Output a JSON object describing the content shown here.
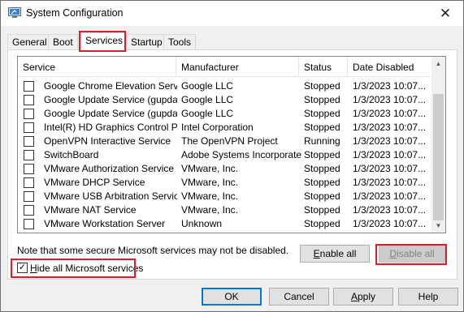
{
  "window": {
    "title": "System Configuration",
    "close_glyph": "✕"
  },
  "tabs": [
    {
      "label": "General",
      "active": false
    },
    {
      "label": "Boot",
      "active": false
    },
    {
      "label": "Services",
      "active": true
    },
    {
      "label": "Startup",
      "active": false
    },
    {
      "label": "Tools",
      "active": false
    }
  ],
  "services": {
    "columns": [
      "Service",
      "Manufacturer",
      "Status",
      "Date Disabled"
    ],
    "rows": [
      {
        "checked": false,
        "service": "Google Chrome Elevation Servic...",
        "manufacturer": "Google LLC",
        "status": "Stopped",
        "date": "1/3/2023 10:07..."
      },
      {
        "checked": false,
        "service": "Google Update Service (gupdate)",
        "manufacturer": "Google LLC",
        "status": "Stopped",
        "date": "1/3/2023 10:07..."
      },
      {
        "checked": false,
        "service": "Google Update Service (gupdatem)",
        "manufacturer": "Google LLC",
        "status": "Stopped",
        "date": "1/3/2023 10:07..."
      },
      {
        "checked": false,
        "service": "Intel(R) HD Graphics Control Pa...",
        "manufacturer": "Intel Corporation",
        "status": "Stopped",
        "date": "1/3/2023 10:07..."
      },
      {
        "checked": false,
        "service": "OpenVPN Interactive Service",
        "manufacturer": "The OpenVPN Project",
        "status": "Running",
        "date": "1/3/2023 10:07..."
      },
      {
        "checked": false,
        "service": "SwitchBoard",
        "manufacturer": "Adobe Systems Incorporated",
        "status": "Stopped",
        "date": "1/3/2023 10:07..."
      },
      {
        "checked": false,
        "service": "VMware Authorization Service",
        "manufacturer": "VMware, Inc.",
        "status": "Stopped",
        "date": "1/3/2023 10:07..."
      },
      {
        "checked": false,
        "service": "VMware DHCP Service",
        "manufacturer": "VMware, Inc.",
        "status": "Stopped",
        "date": "1/3/2023 10:07..."
      },
      {
        "checked": false,
        "service": "VMware USB Arbitration Service",
        "manufacturer": "VMware, Inc.",
        "status": "Stopped",
        "date": "1/3/2023 10:07..."
      },
      {
        "checked": false,
        "service": "VMware NAT Service",
        "manufacturer": "VMware, Inc.",
        "status": "Stopped",
        "date": "1/3/2023 10:07..."
      },
      {
        "checked": false,
        "service": "VMware Workstation Server",
        "manufacturer": "Unknown",
        "status": "Stopped",
        "date": "1/3/2023 10:07..."
      }
    ]
  },
  "note": "Note that some secure Microsoft services may not be disabled.",
  "enable_all": {
    "accel": "E",
    "rest": "nable all"
  },
  "disable_all": {
    "accel": "D",
    "rest": "isable all",
    "disabled": true
  },
  "hide_ms": {
    "accel": "H",
    "rest": "ide all Microsoft services",
    "checked": true,
    "check_glyph": "✓"
  },
  "footer": {
    "ok": "OK",
    "cancel": "Cancel",
    "apply": {
      "accel": "A",
      "rest": "pply"
    },
    "help": "Help"
  },
  "colors": {
    "highlight_box": "#d8202a",
    "default_button_border": "#0078d7"
  }
}
